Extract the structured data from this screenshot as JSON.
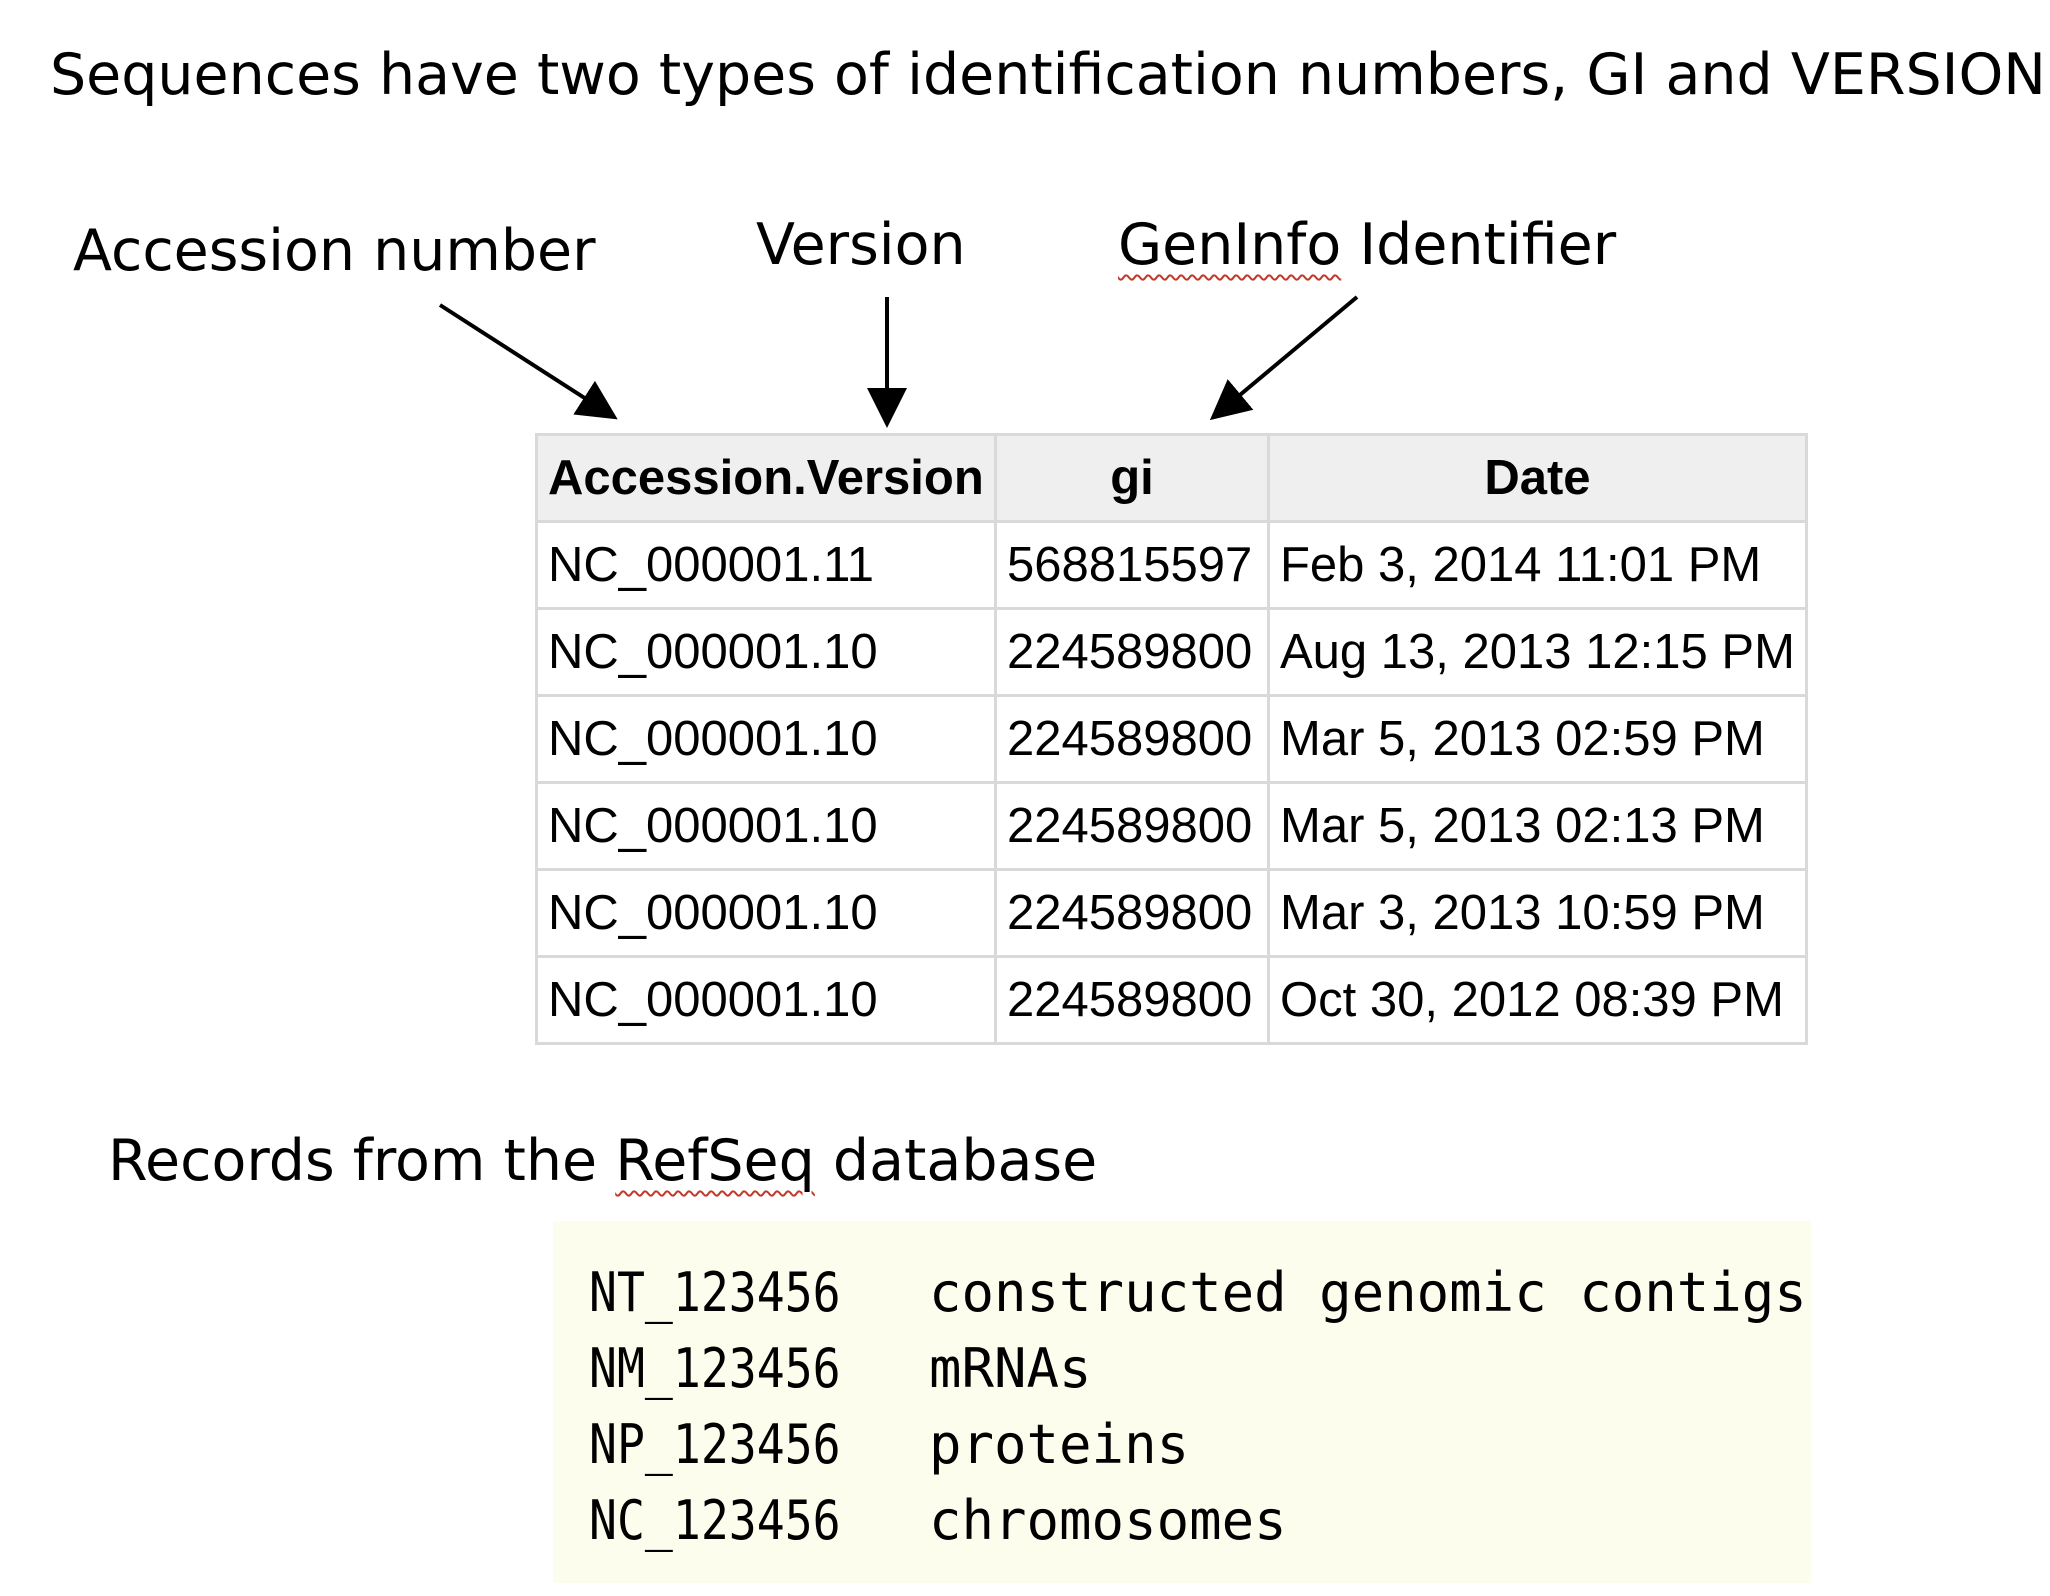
{
  "heading": "Sequences have two types of identification numbers, GI and VERSION",
  "annotations": {
    "accession": "Accession number",
    "version": "Version",
    "geninfo": "GenInfo Identifier"
  },
  "table": {
    "headers": [
      "Accession.Version",
      "gi",
      "Date"
    ],
    "rows": [
      [
        "NC_000001.11",
        "568815597",
        "Feb 3, 2014 11:01 PM"
      ],
      [
        "NC_000001.10",
        "224589800",
        "Aug 13, 2013 12:15 PM"
      ],
      [
        "NC_000001.10",
        "224589800",
        "Mar 5, 2013 02:59 PM"
      ],
      [
        "NC_000001.10",
        "224589800",
        "Mar 5, 2013 02:13 PM"
      ],
      [
        "NC_000001.10",
        "224589800",
        "Mar 3, 2013 10:59 PM"
      ],
      [
        "NC_000001.10",
        "224589800",
        "Oct 30, 2012 08:39 PM"
      ]
    ]
  },
  "records": {
    "caption_before": "Records from the ",
    "caption_link": "RefSeq",
    "caption_after": " database",
    "items": [
      {
        "code": "NT_123456",
        "desc": "constructed genomic contigs"
      },
      {
        "code": "NM_123456",
        "desc": "mRNAs"
      },
      {
        "code": "NP_123456",
        "desc": "proteins"
      },
      {
        "code": "NC_123456",
        "desc": "chromosomes"
      }
    ]
  }
}
